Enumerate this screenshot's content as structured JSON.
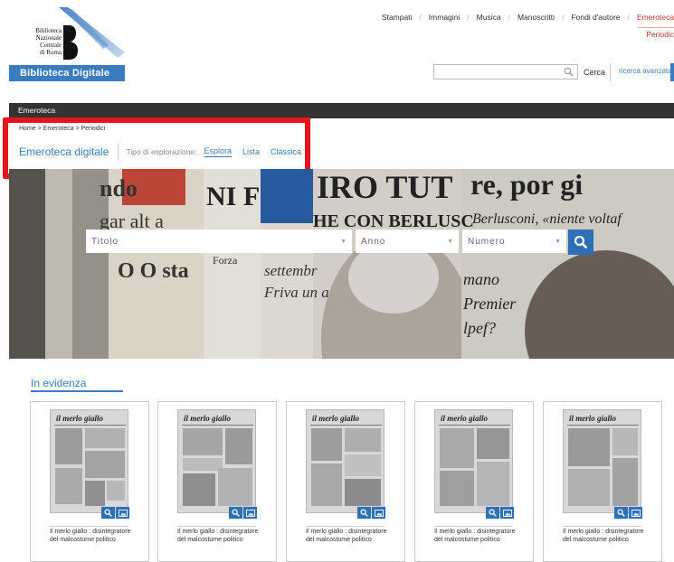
{
  "logo": {
    "lines": [
      "Biblioteca",
      "Nazionale",
      "Centrale",
      "di Roma"
    ],
    "bar_label": "Biblioteca Digitale"
  },
  "topnav": {
    "items": [
      "Stampati",
      "Immagini",
      "Musica",
      "Manoscritti",
      "Fondi d'autore",
      "Emeroteca"
    ],
    "sub_item": "Periodic"
  },
  "search": {
    "value": "",
    "button_label": "Cerca",
    "advanced_label": "ricerca avanzata"
  },
  "section_bar": "Emeroteca",
  "breadcrumb": "Home > Emeroteca > Periodici",
  "subnav": {
    "title": "Emeroteca digitale",
    "tipo_label": "Tipo di esplorazione:",
    "links": [
      "Esplora",
      "Lista",
      "Classica"
    ],
    "active": "Esplora"
  },
  "filters": {
    "titolo": "Titolo",
    "anno": "Anno",
    "numero": "Numero"
  },
  "hero_headlines": [
    "ndo",
    "gar alt a",
    "O O sta",
    "NI F",
    "Forza",
    "settembr",
    "Friva un a",
    "IRO TUT",
    "HE CON BERLUSC",
    "re, por gi",
    "Berlusconi, «niente voltaf",
    "mano",
    "Premier",
    "lpef?"
  ],
  "evidenza": {
    "title": "In evidenza",
    "cards": [
      {
        "masthead": "il merlo giallo",
        "caption": "Il merlo giallo : disintegratore del malcostume politico"
      },
      {
        "masthead": "il merlo giallo",
        "caption": "Il merlo giallo : disintegratore del malcostume politico"
      },
      {
        "masthead": "il merlo giallo",
        "caption": "Il merlo giallo : disintegratore del malcostume politico"
      },
      {
        "masthead": "il merlo giallo",
        "caption": "Il merlo giallo : disintegratore del malcostume politico"
      },
      {
        "masthead": "il merlo giallo",
        "caption": "Il merlo giallo : disintegratore del malcostume politico"
      }
    ]
  },
  "colors": {
    "accent": "#3a7cc1",
    "highlight": "#e8141b",
    "dark_bar": "#333333"
  }
}
